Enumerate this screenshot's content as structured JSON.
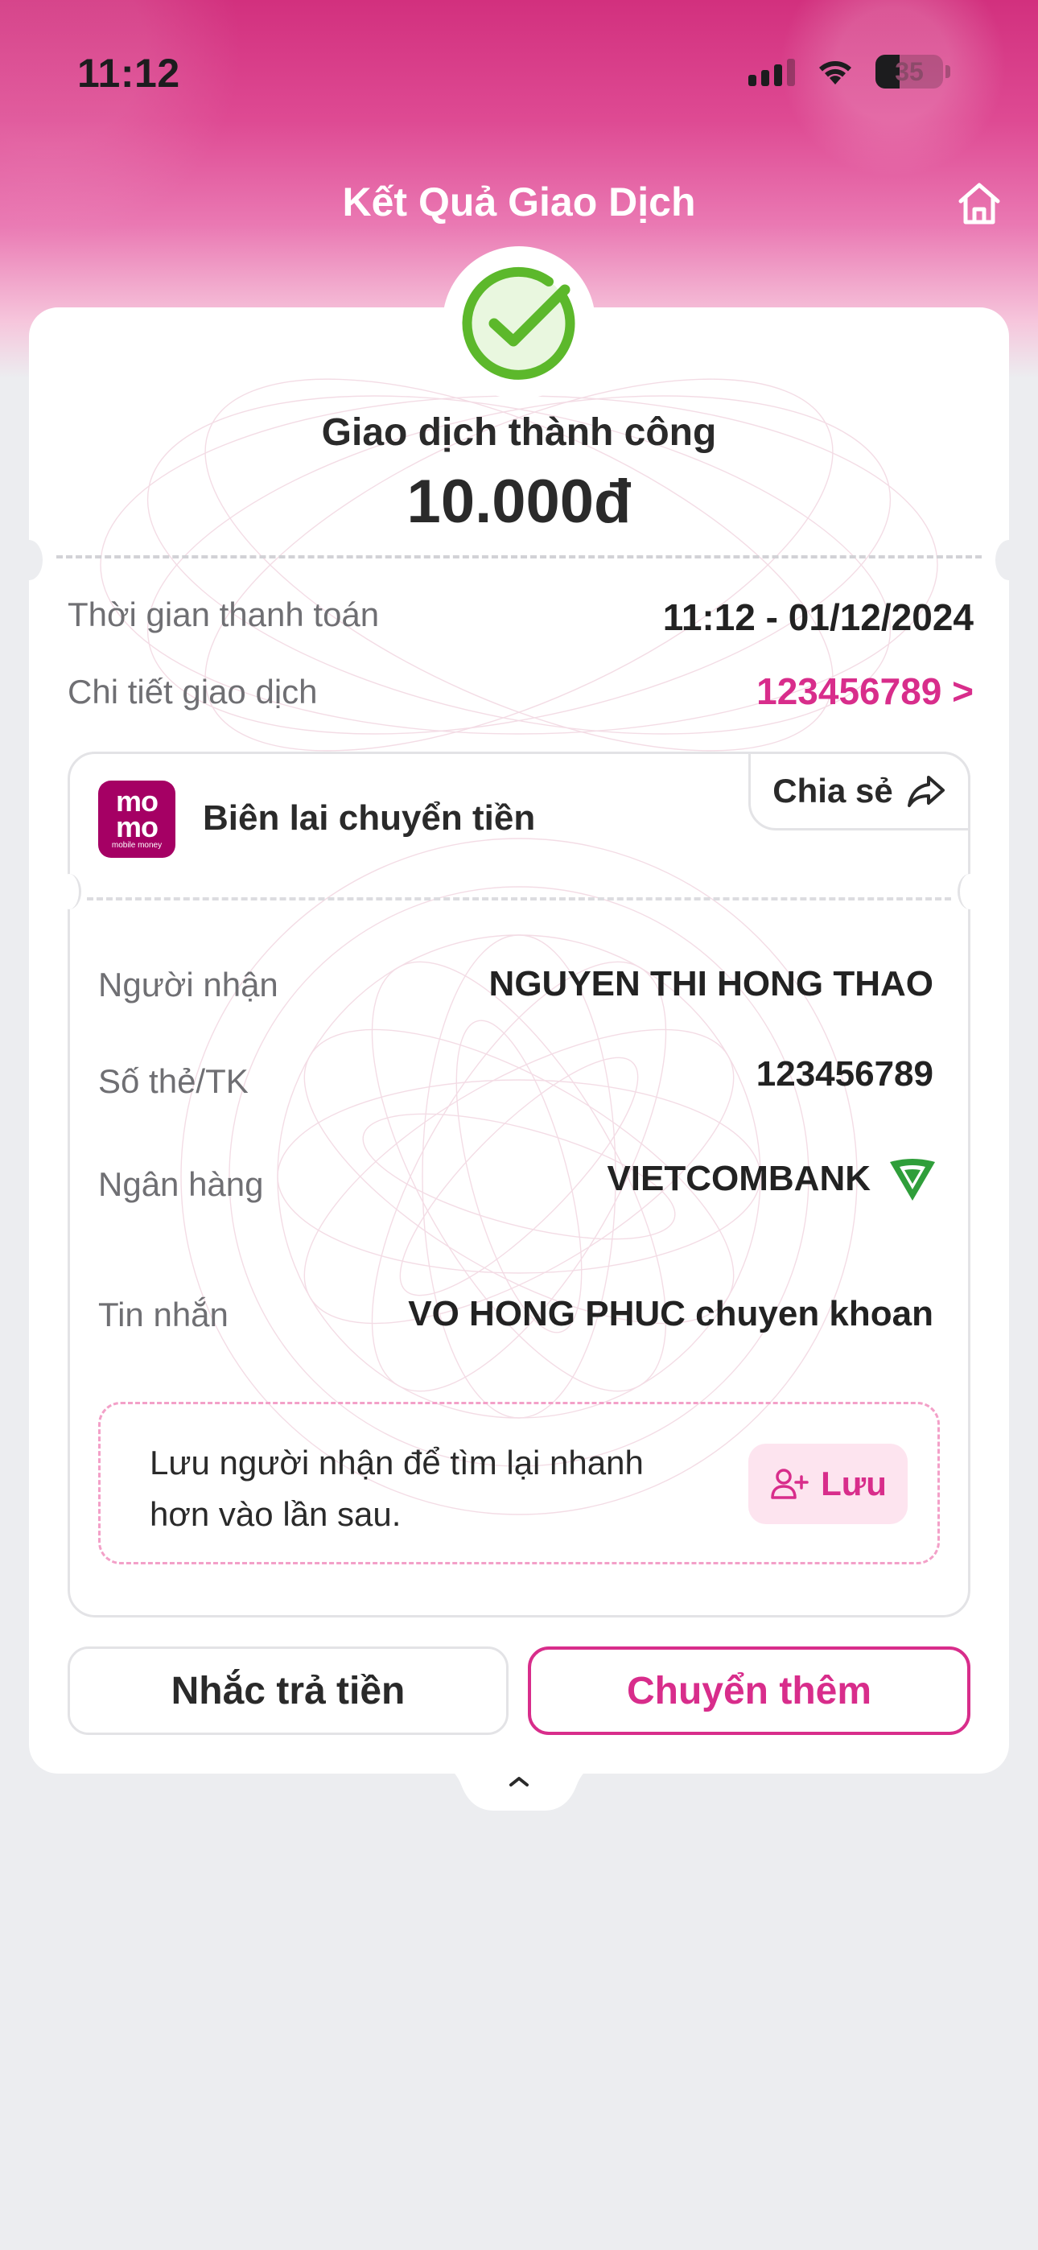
{
  "status_bar": {
    "time": "11:12",
    "battery": "35"
  },
  "header": {
    "title": "Kết Quả Giao Dịch"
  },
  "result": {
    "status_text": "Giao dịch thành công",
    "amount": "10.000đ"
  },
  "summary": {
    "payment_time_label": "Thời gian thanh toán",
    "payment_time_value": "11:12 - 01/12/2024",
    "detail_label": "Chi tiết giao dịch",
    "detail_value": "123456789 >"
  },
  "receipt": {
    "logo_top": "mo",
    "logo_bottom": "mo",
    "logo_caption": "mobile money",
    "title": "Biên lai chuyển tiền",
    "share_label": "Chia sẻ",
    "rows": [
      {
        "label": "Người nhận",
        "value": "NGUYEN THI HONG THAO"
      },
      {
        "label": "Số thẻ/TK",
        "value": "123456789"
      },
      {
        "label": "Ngân hàng",
        "value": "VIETCOMBANK"
      },
      {
        "label": "Tin nhắn",
        "value": "VO HONG PHUC chuyen khoan"
      }
    ],
    "save_hint": "Lưu người nhận để tìm lại nhanh hơn vào lần sau.",
    "save_button": "Lưu"
  },
  "actions": {
    "remind_label": "Nhắc trả tiền",
    "transfer_more_label": "Chuyển thêm"
  },
  "colors": {
    "brand_pink": "#d82d8b",
    "momo_magenta": "#a50064",
    "success_green": "#5cb82b",
    "vietcombank_green": "#2f9e3a"
  },
  "icons": {
    "home": "home-icon",
    "success": "check-circle-icon",
    "share": "share-arrow-icon",
    "add_user": "user-plus-icon",
    "collapse": "chevron-up-icon"
  }
}
